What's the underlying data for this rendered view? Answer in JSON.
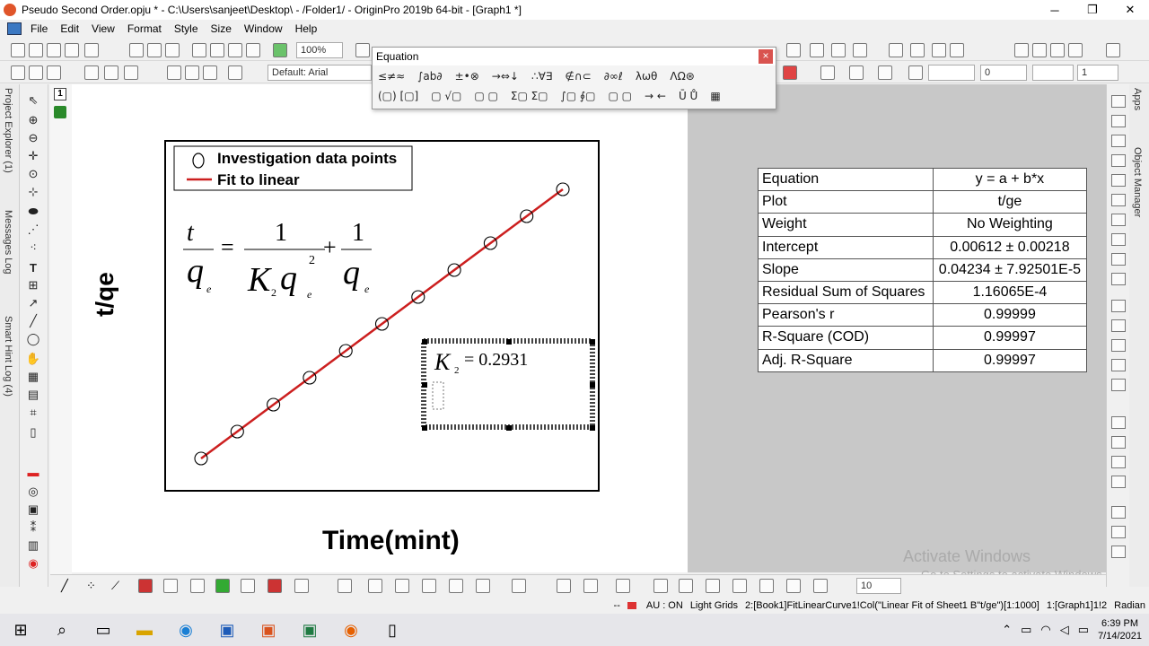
{
  "window": {
    "title": "Pseudo Second Order.opju * - C:\\Users\\sanjeet\\Desktop\\ - /Folder1/ - OriginPro 2019b 64-bit - [Graph1 *]",
    "minimize": "─",
    "restore": "❐",
    "close": "✕"
  },
  "menu": [
    "File",
    "Edit",
    "View",
    "Format",
    "Style",
    "Size",
    "Window",
    "Help"
  ],
  "toolbar": {
    "zoom": "100%",
    "font": "Default: Arial",
    "size1": "0",
    "size2": "1",
    "bottom_size": "10"
  },
  "left_panels": [
    "Project Explorer (1)",
    "Messages Log",
    "Smart Hint Log (4)"
  ],
  "right_panels": [
    "Apps",
    "Object Manager"
  ],
  "layer": "1",
  "equation_toolbar": {
    "title": "Equation",
    "close": "×",
    "row1": [
      "≤≠≈",
      "∫ab∂",
      "±•⊗",
      "→⇔↓",
      "∴∀∃",
      "∉∩⊂",
      "∂∞ℓ",
      "λωθ",
      "ΛΩ⊛"
    ],
    "row2": [
      "(▢) [▢]",
      "▢ √▢",
      "▢ ▢",
      "Σ▢ Σ▢",
      "∫▢ ∮▢",
      "▢ ▢",
      "→ ←",
      "Ū Ů",
      "▦"
    ]
  },
  "graph": {
    "ylabel": "t/qe",
    "xlabel": "Time(mint)",
    "legend": [
      "Investigation data points",
      "Fit to linear"
    ],
    "line_color": "#cc1f1f",
    "k2_label": "= 0.2931"
  },
  "chart_data": {
    "type": "scatter",
    "title": "",
    "xlabel": "Time(mint)",
    "ylabel": "t/qe",
    "series": [
      {
        "name": "Investigation data points",
        "values": [
          1,
          2,
          3,
          4,
          5,
          6,
          7,
          8,
          9,
          10,
          11
        ]
      },
      {
        "name": "Fit to linear",
        "values": [
          1,
          11
        ]
      }
    ],
    "grid": false,
    "legend_position": "top-left"
  },
  "stats": [
    {
      "label": "Equation",
      "value": "y = a + b*x"
    },
    {
      "label": "Plot",
      "value": "t/ge"
    },
    {
      "label": "Weight",
      "value": "No Weighting"
    },
    {
      "label": "Intercept",
      "value": "0.00612 ± 0.00218"
    },
    {
      "label": "Slope",
      "value": "0.04234 ± 7.92501E-5"
    },
    {
      "label": "Residual Sum of Squares",
      "value": "1.16065E-4"
    },
    {
      "label": "Pearson's r",
      "value": "0.99999"
    },
    {
      "label": "R-Square (COD)",
      "value": "0.99997"
    },
    {
      "label": "Adj. R-Square",
      "value": "0.99997"
    }
  ],
  "status": {
    "dots": "--",
    "au": "AU : ON",
    "grids": "Light Grids",
    "info": "2:[Book1]FitLinearCurve1!Col(\"Linear Fit of Sheet1 B\"t/ge\")[1:1000]",
    "graph": "1:[Graph1]1!2",
    "unit": "Radian"
  },
  "watermark": {
    "line1": "Activate Windows",
    "line2": "Go to Settings to activate Windows."
  },
  "taskbar": {
    "time": "6:39 PM",
    "date": "7/14/2021"
  }
}
